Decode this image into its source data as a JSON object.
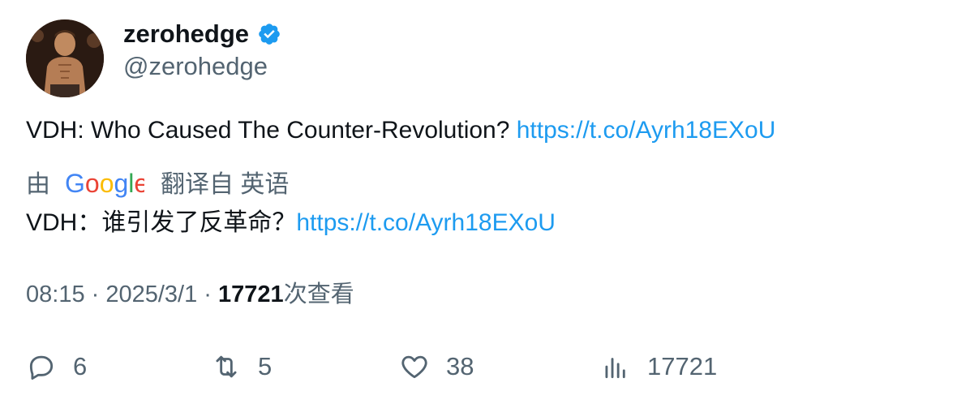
{
  "author": {
    "display_name": "zerohedge",
    "handle": "@zerohedge",
    "verified_icon": "verified-badge-icon",
    "avatar_icon": "avatar"
  },
  "tweet": {
    "text": "VDH: Who Caused The Counter-Revolution? ",
    "link": "https://t.co/Ayrh18EXoU"
  },
  "translation": {
    "by_label": "由",
    "provider": "Google",
    "from_label": "翻译自 英语",
    "text": "VDH：谁引发了反革命？",
    "link": "https://t.co/Ayrh18EXoU"
  },
  "meta": {
    "time": "08:15",
    "separator": " · ",
    "date": "2025/3/1",
    "views_count": "17721",
    "views_label": "次查看"
  },
  "actions": {
    "replies": "6",
    "retweets": "5",
    "likes": "38",
    "views": "17721"
  },
  "colors": {
    "link": "#1d9bf0",
    "secondary_text": "#536471",
    "primary_text": "#0f1419",
    "verified": "#1d9bf0"
  }
}
